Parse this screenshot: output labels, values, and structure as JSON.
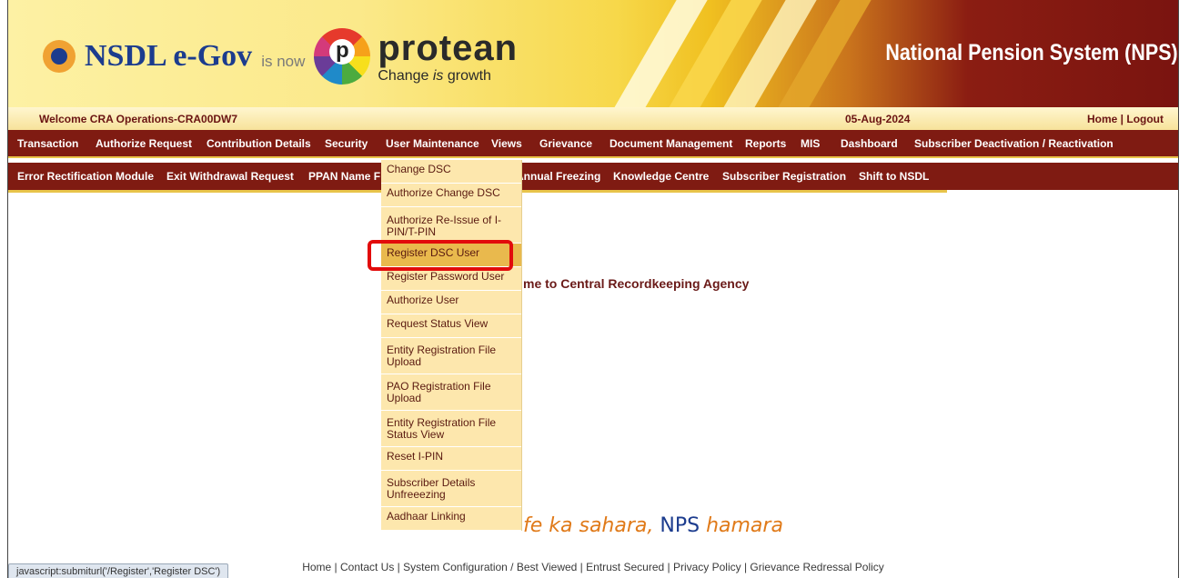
{
  "header": {
    "nsdl_brand": "NSDL e-Gov",
    "is_now": "is now",
    "protean_name": "protean",
    "protean_tagline_a": "Change ",
    "protean_tagline_b": "is",
    "protean_tagline_c": " growth",
    "nps_title": "National Pension System (NPS)",
    "colors": {
      "maroon": "#7f1b12",
      "gold": "#e8c44a",
      "navy": "#1c3c8e"
    }
  },
  "welcome_bar": {
    "user": "Welcome CRA Operations-CRA00DW7",
    "date": "05-Aug-2024",
    "links": "Home | Logout"
  },
  "menu_row1": [
    "Transaction",
    "Authorize Request",
    "Contribution Details",
    "Security",
    "User Maintenance",
    "Views",
    "Grievance",
    "Document Management",
    "Reports",
    "MIS",
    "Dashboard",
    "Subscriber Deactivation / Reactivation"
  ],
  "menu_row2": [
    "Error Rectification Module",
    "Exit Withdrawal Request",
    "PPAN Name F",
    "Annual Freezing",
    "Knowledge Centre",
    "Subscriber Registration",
    "Shift to NSDL"
  ],
  "dropdown": [
    "Change DSC",
    "Authorize Change DSC",
    "Authorize Re-Issue of I-PIN/T-PIN",
    "Register DSC User",
    "Register Password User",
    "Authorize User",
    "Request Status View",
    "Entity Registration File Upload",
    "PAO Registration File Upload",
    "Entity Registration File Status View",
    "Reset I-PIN",
    "Subscriber Details Unfreeezing",
    "Aadhaar Linking"
  ],
  "content": {
    "welcome_message": "me to Central Recordkeeping Agency",
    "slogan_a": "fe ka sahara, ",
    "slogan_b": "NPS",
    "slogan_c": " hamara"
  },
  "footer": {
    "links": "Home | Contact Us | System Configuration / Best Viewed | Entrust Secured | Privacy Policy | Grievance Redressal Policy",
    "status_url": "javascript:submiturl('/Register','Register DSC')"
  }
}
